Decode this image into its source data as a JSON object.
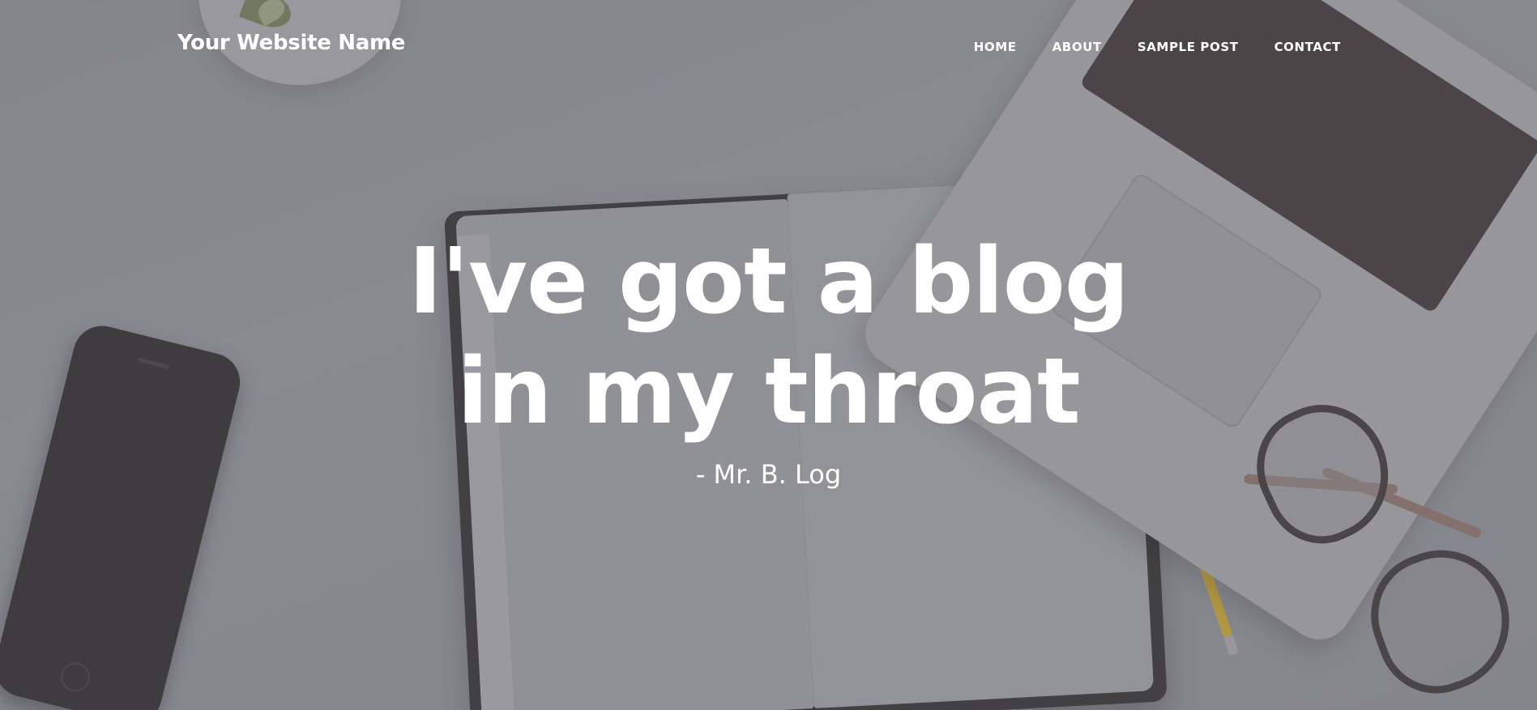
{
  "site": {
    "brand": "Your Website Name"
  },
  "nav": {
    "items": [
      {
        "label": "HOME"
      },
      {
        "label": "ABOUT"
      },
      {
        "label": "SAMPLE POST"
      },
      {
        "label": "CONTACT"
      }
    ]
  },
  "hero": {
    "headline_line1": "I've got a blog",
    "headline_line2": "in my throat",
    "subheading": "- Mr. B. Log"
  },
  "colors": {
    "text": "#ffffff",
    "overlay": "#78787f"
  }
}
